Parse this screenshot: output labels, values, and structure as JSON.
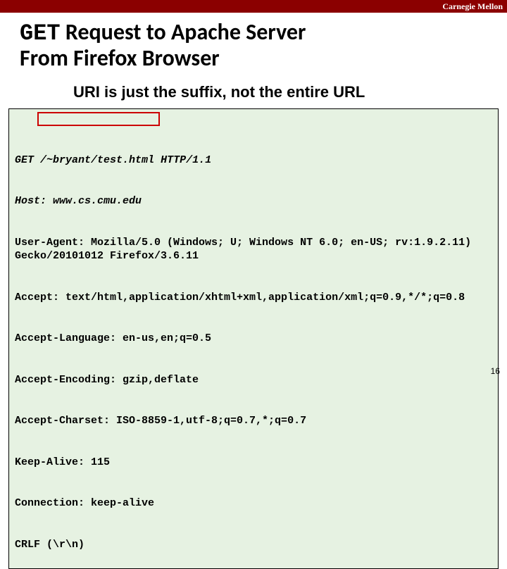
{
  "topbar": {
    "brand": "Carnegie Mellon"
  },
  "title": {
    "method": "GET",
    "rest1": " Request to Apache Server",
    "line2": "From Firefox Browser"
  },
  "subtitle": "URI is just the suffix, not the entire URL",
  "code": {
    "l1_method": "GET",
    "l1_uri": "/~bryant/test.html",
    "l1_proto": "HTTP/1.1",
    "l2": "Host: www.cs.cmu.edu",
    "l3": "User-Agent: Mozilla/5.0 (Windows; U; Windows NT 6.0; en-US; rv:1.9.2.11) Gecko/20101012 Firefox/3.6.11",
    "l4": "Accept: text/html,application/xhtml+xml,application/xml;q=0.9,*/*;q=0.8",
    "l5": "Accept-Language: en-us,en;q=0.5",
    "l6": "Accept-Encoding: gzip,deflate",
    "l7": "Accept-Charset: ISO-8859-1,utf-8;q=0.7,*;q=0.7",
    "l8": "Keep-Alive: 115",
    "l9": "Connection: keep-alive",
    "l10": "CRLF (\\r\\n)"
  },
  "pagenum": "16"
}
